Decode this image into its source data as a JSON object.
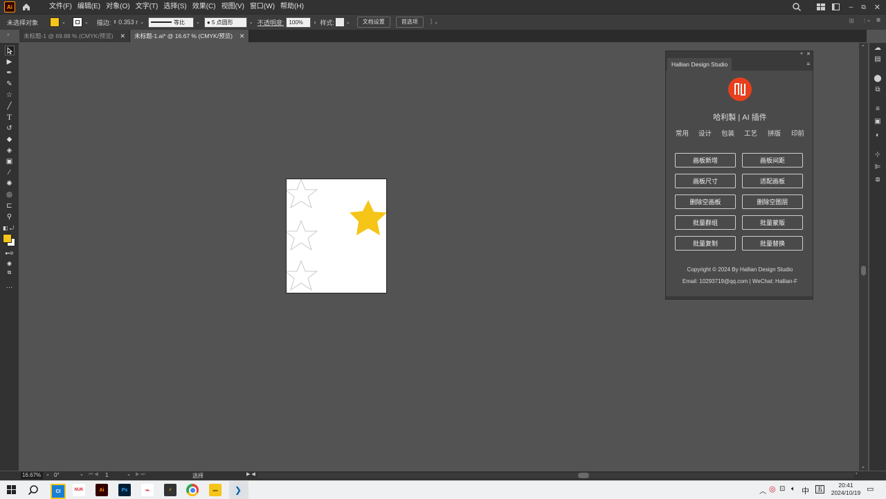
{
  "menubar": {
    "app_logo": "Ai",
    "items": [
      "文件(F)",
      "编辑(E)",
      "对象(O)",
      "文字(T)",
      "选择(S)",
      "效果(C)",
      "视图(V)",
      "窗口(W)",
      "帮助(H)"
    ]
  },
  "controlbar": {
    "selection_status": "未选择对象",
    "fill_color": "#f5c518",
    "stroke_label": "描边:",
    "stroke_value": "0.353 r",
    "line_style_label": "等比",
    "brush_label": "5 点圆形",
    "opacity_label": "不透明度:",
    "opacity_value": "100%",
    "style_label": "样式:",
    "doc_setup_button": "文档设置",
    "preferences_button": "首选项"
  },
  "tabs": [
    {
      "label": "未标题-1 @ 69.88 % (CMYK/预览)",
      "active": false
    },
    {
      "label": "未标题-1.ai* @ 16.67 % (CMYK/预览)",
      "active": true
    }
  ],
  "panel": {
    "tab_label": "Hallian Design Studio",
    "title": "哈利製 | AI 插件",
    "nav": [
      "常用",
      "设计",
      "包装",
      "工艺",
      "拼版",
      "印前"
    ],
    "buttons": [
      "画板新增",
      "画板间距",
      "画板尺寸",
      "适配画板",
      "删除空画板",
      "删除空图层",
      "批量群组",
      "批量蒙版",
      "批量复制",
      "批量替换"
    ],
    "copyright": "Copyright © 2024 By Hallian Design Studio",
    "contact": "Email: 10293719@qq.com | WeChat: Hallian-F",
    "accent": "#e8401c"
  },
  "statusbar": {
    "zoom": "16.67%",
    "rotation": "0°",
    "artboard_number": "1",
    "tool_name": "选择"
  },
  "taskbar": {
    "time": "20:41",
    "date": "2024/10/19",
    "ime": "中",
    "icons": [
      "windows-start",
      "search",
      "app-blue",
      "nuk",
      "illustrator",
      "photoshop",
      "pdf",
      "app-dark",
      "chrome",
      "file-explorer",
      "vscode"
    ]
  }
}
